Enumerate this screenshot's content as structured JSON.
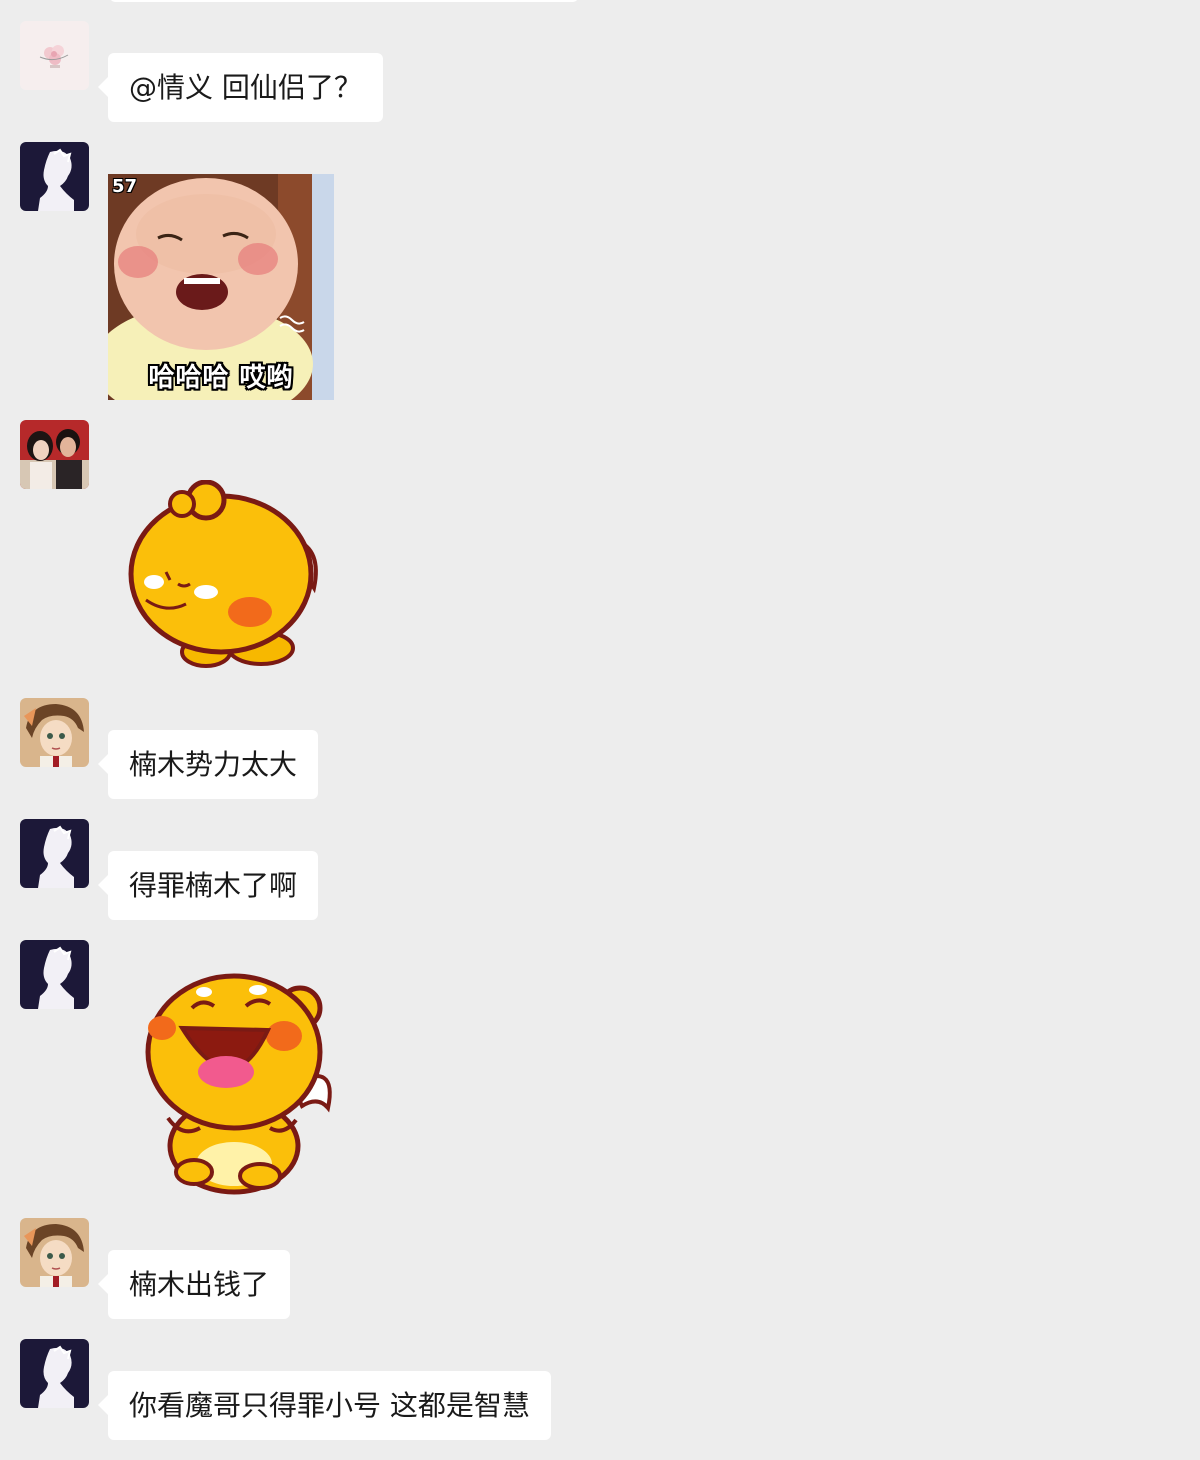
{
  "colors": {
    "background": "#ededed",
    "bubble": "#ffffff",
    "text": "#1a1a1a"
  },
  "messages": [
    {
      "type": "text",
      "avatar": "flower-avatar",
      "text": "@情义  回仙侣了？"
    },
    {
      "type": "sticker",
      "avatar": "silhouette-avatar",
      "sticker": "laughing-baby-sticker",
      "badge": "57",
      "caption": "哈哈哈 哎哟"
    },
    {
      "type": "sticker",
      "avatar": "couple-avatar",
      "sticker": "yellow-mascot-shy-sticker"
    },
    {
      "type": "text",
      "avatar": "anime-avatar",
      "text": "楠木势力太大"
    },
    {
      "type": "text",
      "avatar": "silhouette-avatar",
      "text": "得罪楠木了啊"
    },
    {
      "type": "sticker",
      "avatar": "silhouette-avatar",
      "sticker": "yellow-mascot-laughing-sticker"
    },
    {
      "type": "text",
      "avatar": "anime-avatar",
      "text": "楠木出钱了"
    },
    {
      "type": "text",
      "avatar": "silhouette-avatar",
      "text": "你看魔哥只得罪小号 这都是智慧"
    }
  ]
}
